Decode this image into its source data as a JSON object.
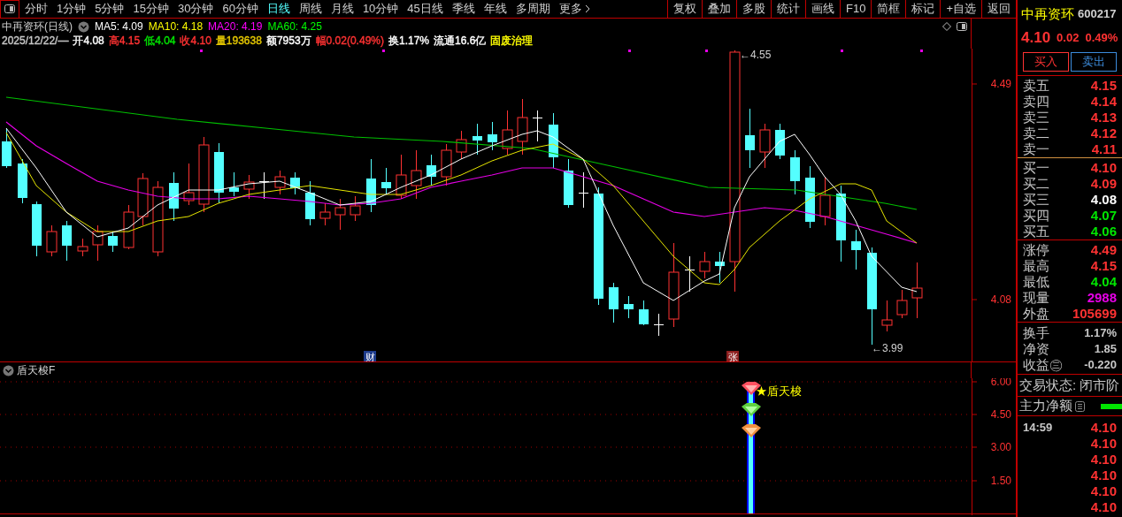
{
  "toolbar": {
    "tabs": [
      {
        "label": "分时",
        "selected": false
      },
      {
        "label": "1分钟",
        "selected": false
      },
      {
        "label": "5分钟",
        "selected": false
      },
      {
        "label": "15分钟",
        "selected": false
      },
      {
        "label": "30分钟",
        "selected": false
      },
      {
        "label": "60分钟",
        "selected": false
      },
      {
        "label": "日线",
        "selected": true
      },
      {
        "label": "周线",
        "selected": false
      },
      {
        "label": "月线",
        "selected": false
      },
      {
        "label": "10分钟",
        "selected": false
      },
      {
        "label": "45日线",
        "selected": false
      },
      {
        "label": "季线",
        "selected": false
      },
      {
        "label": "年线",
        "selected": false
      },
      {
        "label": "多周期",
        "selected": false
      },
      {
        "label": "更多",
        "selected": false
      }
    ],
    "buttons": [
      "复权",
      "叠加",
      "多股",
      "统计",
      "画线",
      "F10",
      "简框",
      "标记",
      "+自选",
      "返回"
    ]
  },
  "chart": {
    "title": "中再资环(日线)",
    "ma": [
      {
        "label": "MA5: 4.09",
        "color": "#ffffff"
      },
      {
        "label": "MA10: 4.18",
        "color": "#ffff00"
      },
      {
        "label": "MA20: 4.19",
        "color": "#ff00ff"
      },
      {
        "label": "MA60: 4.25",
        "color": "#00ff00"
      }
    ],
    "quote": [
      {
        "text": "2025/12/22/—",
        "color": "#c8c8c8"
      },
      {
        "text": "开4.08",
        "color": "#ffffff"
      },
      {
        "text": "高4.15",
        "color": "#ff3232"
      },
      {
        "text": "低4.04",
        "color": "#00e600"
      },
      {
        "text": "收4.10",
        "color": "#ff3232"
      },
      {
        "text": "量193638",
        "color": "#e6c800"
      },
      {
        "text": "额7953万",
        "color": "#ffffff"
      },
      {
        "text": "幅0.02(0.49%)",
        "color": "#ff3232"
      },
      {
        "text": "换1.17%",
        "color": "#ffffff"
      },
      {
        "text": "流通16.6亿",
        "color": "#ffffff"
      },
      {
        "text": "固废治理",
        "color": "#ffff00"
      }
    ],
    "y_labels": [
      "4.49",
      "4.08"
    ],
    "high_label": "←4.55",
    "low_label": "←3.99",
    "markers": [
      "财",
      "张"
    ]
  },
  "indicator": {
    "title": "盾天梭F",
    "signal_label": "★盾天梭",
    "y_labels": [
      "6.00",
      "4.50",
      "3.00",
      "1.50"
    ]
  },
  "quote_panel": {
    "name": "中再资环",
    "code": "600217",
    "price": "4.10",
    "change": "0.02",
    "change_pct": "0.49%",
    "buy_button": "买入",
    "sell_button": "卖出",
    "sell_orders": [
      {
        "label": "卖五",
        "price": "4.15",
        "color": "#ff3232"
      },
      {
        "label": "卖四",
        "price": "4.14",
        "color": "#ff3232"
      },
      {
        "label": "卖三",
        "price": "4.13",
        "color": "#ff3232"
      },
      {
        "label": "卖二",
        "price": "4.12",
        "color": "#ff3232"
      },
      {
        "label": "卖一",
        "price": "4.11",
        "color": "#ff3232"
      }
    ],
    "buy_orders": [
      {
        "label": "买一",
        "price": "4.10",
        "color": "#ff3232"
      },
      {
        "label": "买二",
        "price": "4.09",
        "color": "#ff3232"
      },
      {
        "label": "买三",
        "price": "4.08",
        "color": "#ffffff"
      },
      {
        "label": "买四",
        "price": "4.07",
        "color": "#00e600"
      },
      {
        "label": "买五",
        "price": "4.06",
        "color": "#00e600"
      }
    ],
    "stats": [
      {
        "label": "涨停",
        "value": "4.49",
        "color": "#ff3232"
      },
      {
        "label": "最高",
        "value": "4.15",
        "color": "#ff3232"
      },
      {
        "label": "最低",
        "value": "4.04",
        "color": "#00e600"
      },
      {
        "label": "现量",
        "value": "2988",
        "color": "#e600e6"
      },
      {
        "label": "外盘",
        "value": "105699",
        "color": "#ff3232"
      }
    ],
    "finance": [
      {
        "label": "换手",
        "value": "1.17%"
      },
      {
        "label": "净资",
        "value": "1.85"
      },
      {
        "label": "收益㊂",
        "value": "-0.220"
      }
    ],
    "status": "交易状态: 闭市阶",
    "main_flow": "主力净额",
    "ticks": [
      {
        "time": "14:59",
        "price": "4.10"
      },
      {
        "price": "4.10"
      },
      {
        "price": "4.10"
      },
      {
        "price": "4.10"
      },
      {
        "price": "4.10"
      },
      {
        "price": "4.10"
      }
    ]
  }
}
